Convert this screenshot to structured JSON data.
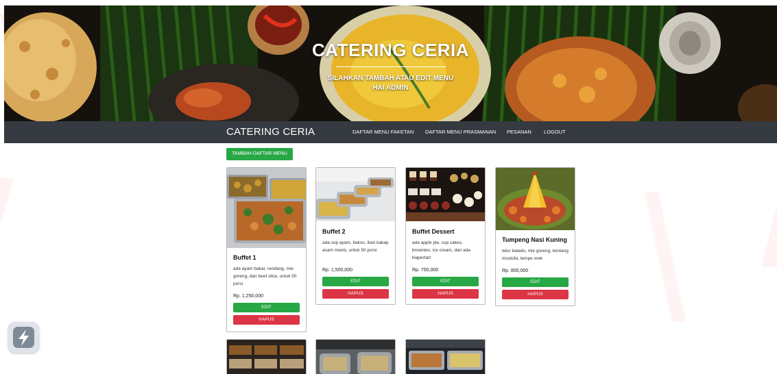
{
  "hero": {
    "title": "CATERING CERIA",
    "subtitle": "SILAHKAN TAMBAH ATAU EDIT MENU",
    "greeting": "HAI ADMIN"
  },
  "navbar": {
    "brand": "CATERING CERIA",
    "links": [
      "DAFTAR MENU FAKETAN",
      "DAFTAR MENU PRASMANAN",
      "PESANAN",
      "LOGOUT"
    ]
  },
  "actions": {
    "add_label": "TAMBAH DAFTAR MENU"
  },
  "cards": [
    {
      "title": "Buffet 1",
      "desc": "ada ayam bakar, rendang, mie goreng, dan beef slice, untuk 50 porsi",
      "price": "Rp. 1,250,000",
      "edit": "EDIT",
      "delete": "HAPUS"
    },
    {
      "title": "Buffet 2",
      "desc": "ada sop ayam, bakso, ikan kakap asam manis, untuk 50 porsi",
      "price": "Rp. 1,500,000",
      "edit": "EDIT",
      "delete": "HAPUS"
    },
    {
      "title": "Buffet Dessert",
      "desc": "ada apple pie, cup cakes, brownies, ice cream, dan ada klapertart",
      "price": "Rp. 750,000",
      "edit": "EDIT",
      "delete": "HAPUS"
    },
    {
      "title": "Tumpeng Nasi Kuning",
      "desc": "telur balado, mie goreng, kentang mustofa, tempe orek",
      "price": "Rp. 800,000",
      "edit": "EDIT",
      "delete": "HAPUS"
    }
  ],
  "colors": {
    "navbar": "#343a40",
    "success": "#28a745",
    "danger": "#dc3545"
  },
  "icons": [
    "app-shortcut-icon"
  ]
}
